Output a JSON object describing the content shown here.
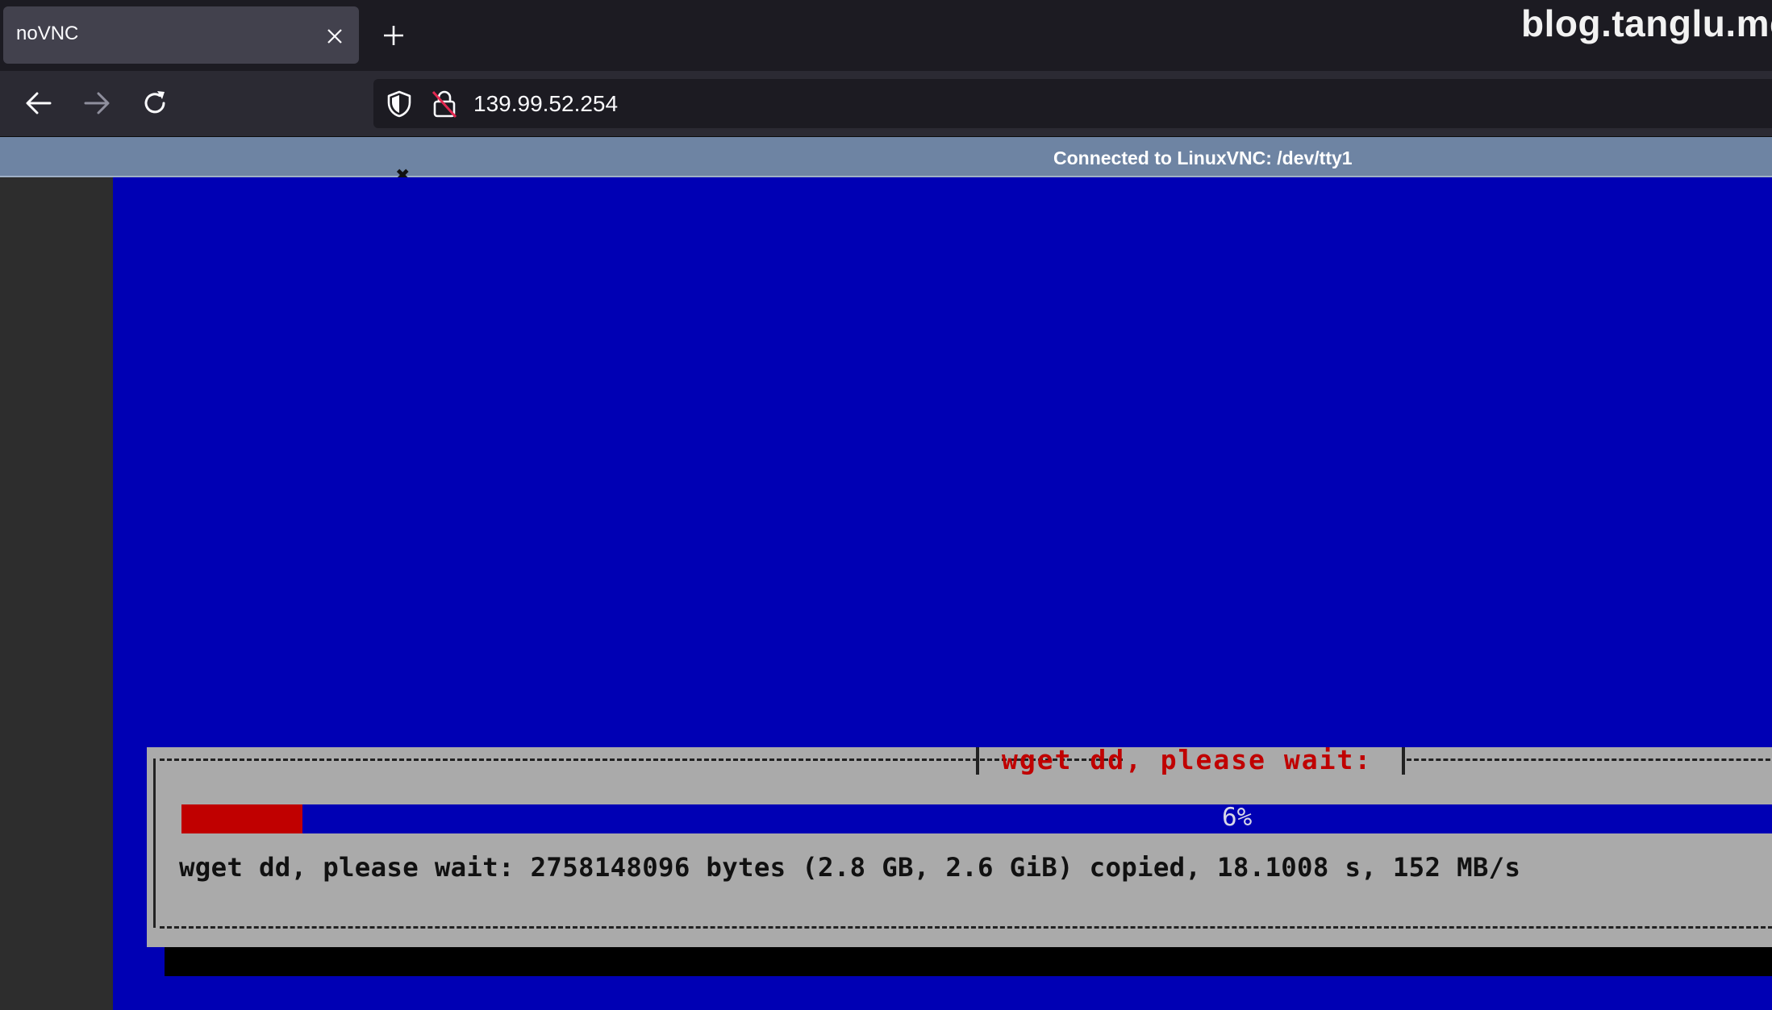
{
  "browser": {
    "tab_title": "noVNC",
    "url": "139.99.52.254"
  },
  "watermark": "blog.tanglu.me",
  "icons": {
    "tab_close": "close-icon",
    "new_tab": "plus-icon",
    "back": "arrow-left-icon",
    "forward": "arrow-right-icon",
    "reload": "reload-icon",
    "tracking": "shield-icon",
    "security": "insecure-lock-icon"
  },
  "novnc": {
    "status_text": "Connected to LinuxVNC: /dev/tty1",
    "status_close": "✖"
  },
  "dialog": {
    "title": "wget dd, please wait:",
    "progress_label": "6%",
    "progress_fraction": 0.076,
    "message": "wget dd, please wait: 2758148096 bytes (2.8 GB, 2.6 GiB) copied, 18.1008 s, 152 MB/s"
  },
  "colors": {
    "screen_background": "#0000b4",
    "dialog_background": "#aaaaaa",
    "accent_red": "#c00000",
    "status_bar": "#6e84a3"
  }
}
